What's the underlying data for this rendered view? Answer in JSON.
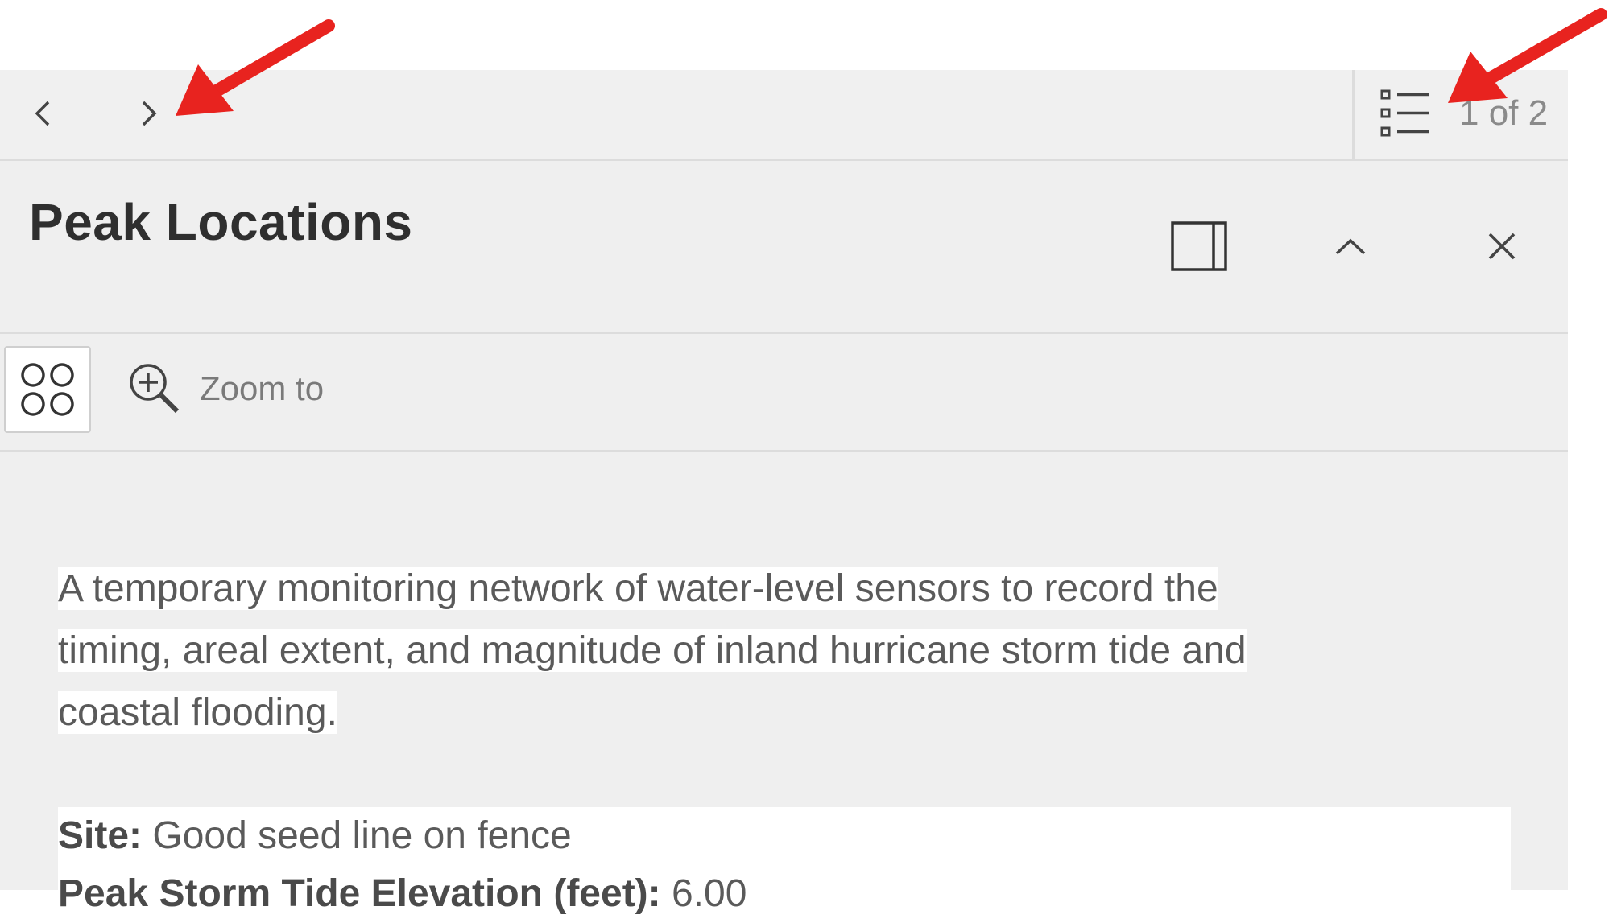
{
  "navigation": {
    "page_count": "1 of 2"
  },
  "header": {
    "title": "Peak Locations"
  },
  "toolbar": {
    "zoom_label": "Zoom to"
  },
  "content": {
    "description_lines": [
      "A temporary monitoring network of water-level sensors to record the",
      "timing, areal extent, and magnitude of inland hurricane storm tide and",
      "coastal flooding."
    ],
    "fields": [
      {
        "label": "Site:",
        "value": "Good seed line on fence"
      },
      {
        "label": "Peak Storm Tide Elevation (feet):",
        "value": "6.00"
      }
    ]
  },
  "icons": {
    "previous": "chevron-left-icon",
    "next": "chevron-right-icon",
    "list": "list-icon",
    "dock": "dock-panel-icon",
    "collapse": "chevron-up-icon",
    "close": "close-icon",
    "select_feature": "select-feature-icon",
    "zoom": "zoom-in-icon",
    "annotation": "red-arrow-icon"
  },
  "colors": {
    "annotation_arrow": "#e8231f",
    "panel_background": "#efefef"
  }
}
